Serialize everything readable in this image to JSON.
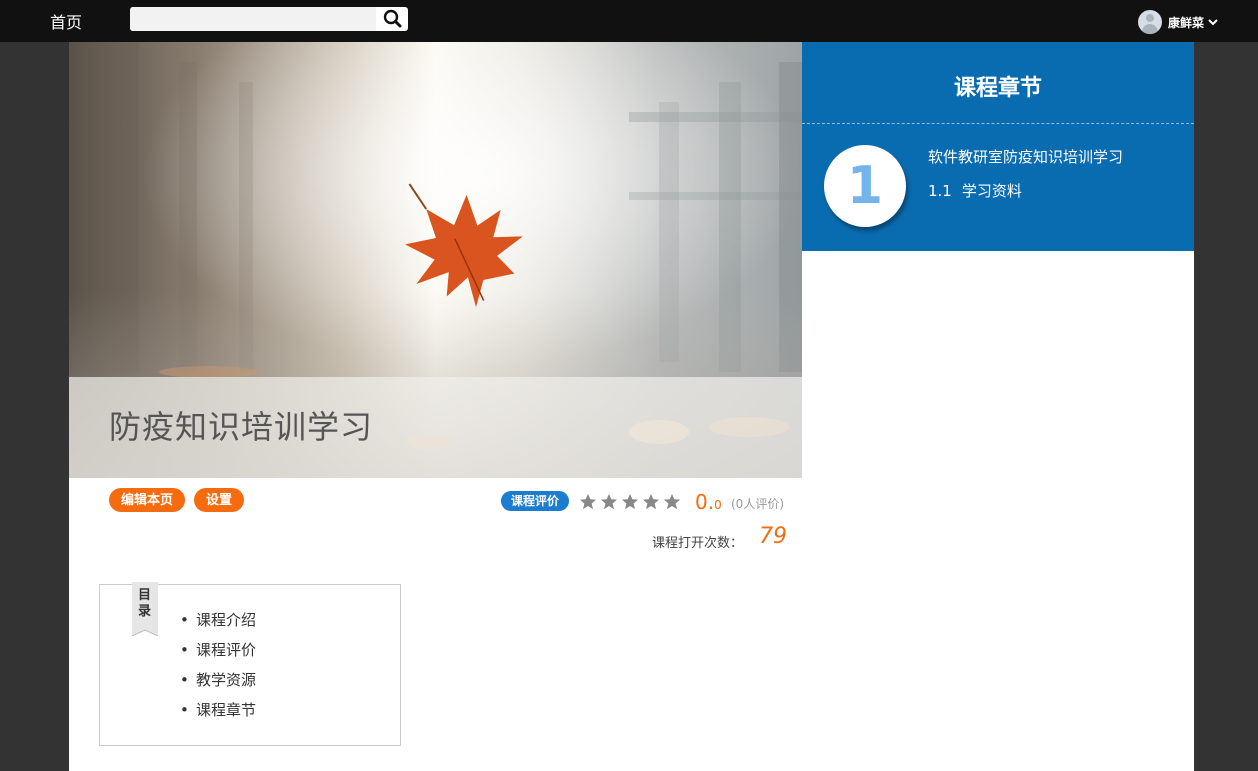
{
  "topbar": {
    "home_label": "首页",
    "search_placeholder": "",
    "search_icon": "search-icon",
    "user_name": "康鲜菜",
    "dropdown_icon": "chevron-down-icon"
  },
  "banner": {
    "title": "防疫知识培训学习"
  },
  "actions": {
    "edit_label": "编辑本页",
    "settings_label": "设置"
  },
  "rating": {
    "badge_label": "课程评价",
    "stars_filled": 0,
    "stars_total": 5,
    "score_main": "0.",
    "score_decimal": "0",
    "review_text": "(0人评价)",
    "star_color": "#888888"
  },
  "opens": {
    "label": "课程打开次数：",
    "count": "79"
  },
  "toc": {
    "ribbon_label": "目录",
    "items": [
      "课程介绍",
      "课程评价",
      "教学资源",
      "课程章节"
    ]
  },
  "chapters": {
    "title": "课程章节",
    "number": "1",
    "name": "软件教研室防疫知识培训学习",
    "sub_number": "1.1",
    "sub_title": "学习资料"
  },
  "colors": {
    "accent_orange": "#f66b0e",
    "accent_blue": "#0a6cb0",
    "badge_blue": "#1c7ccf"
  }
}
